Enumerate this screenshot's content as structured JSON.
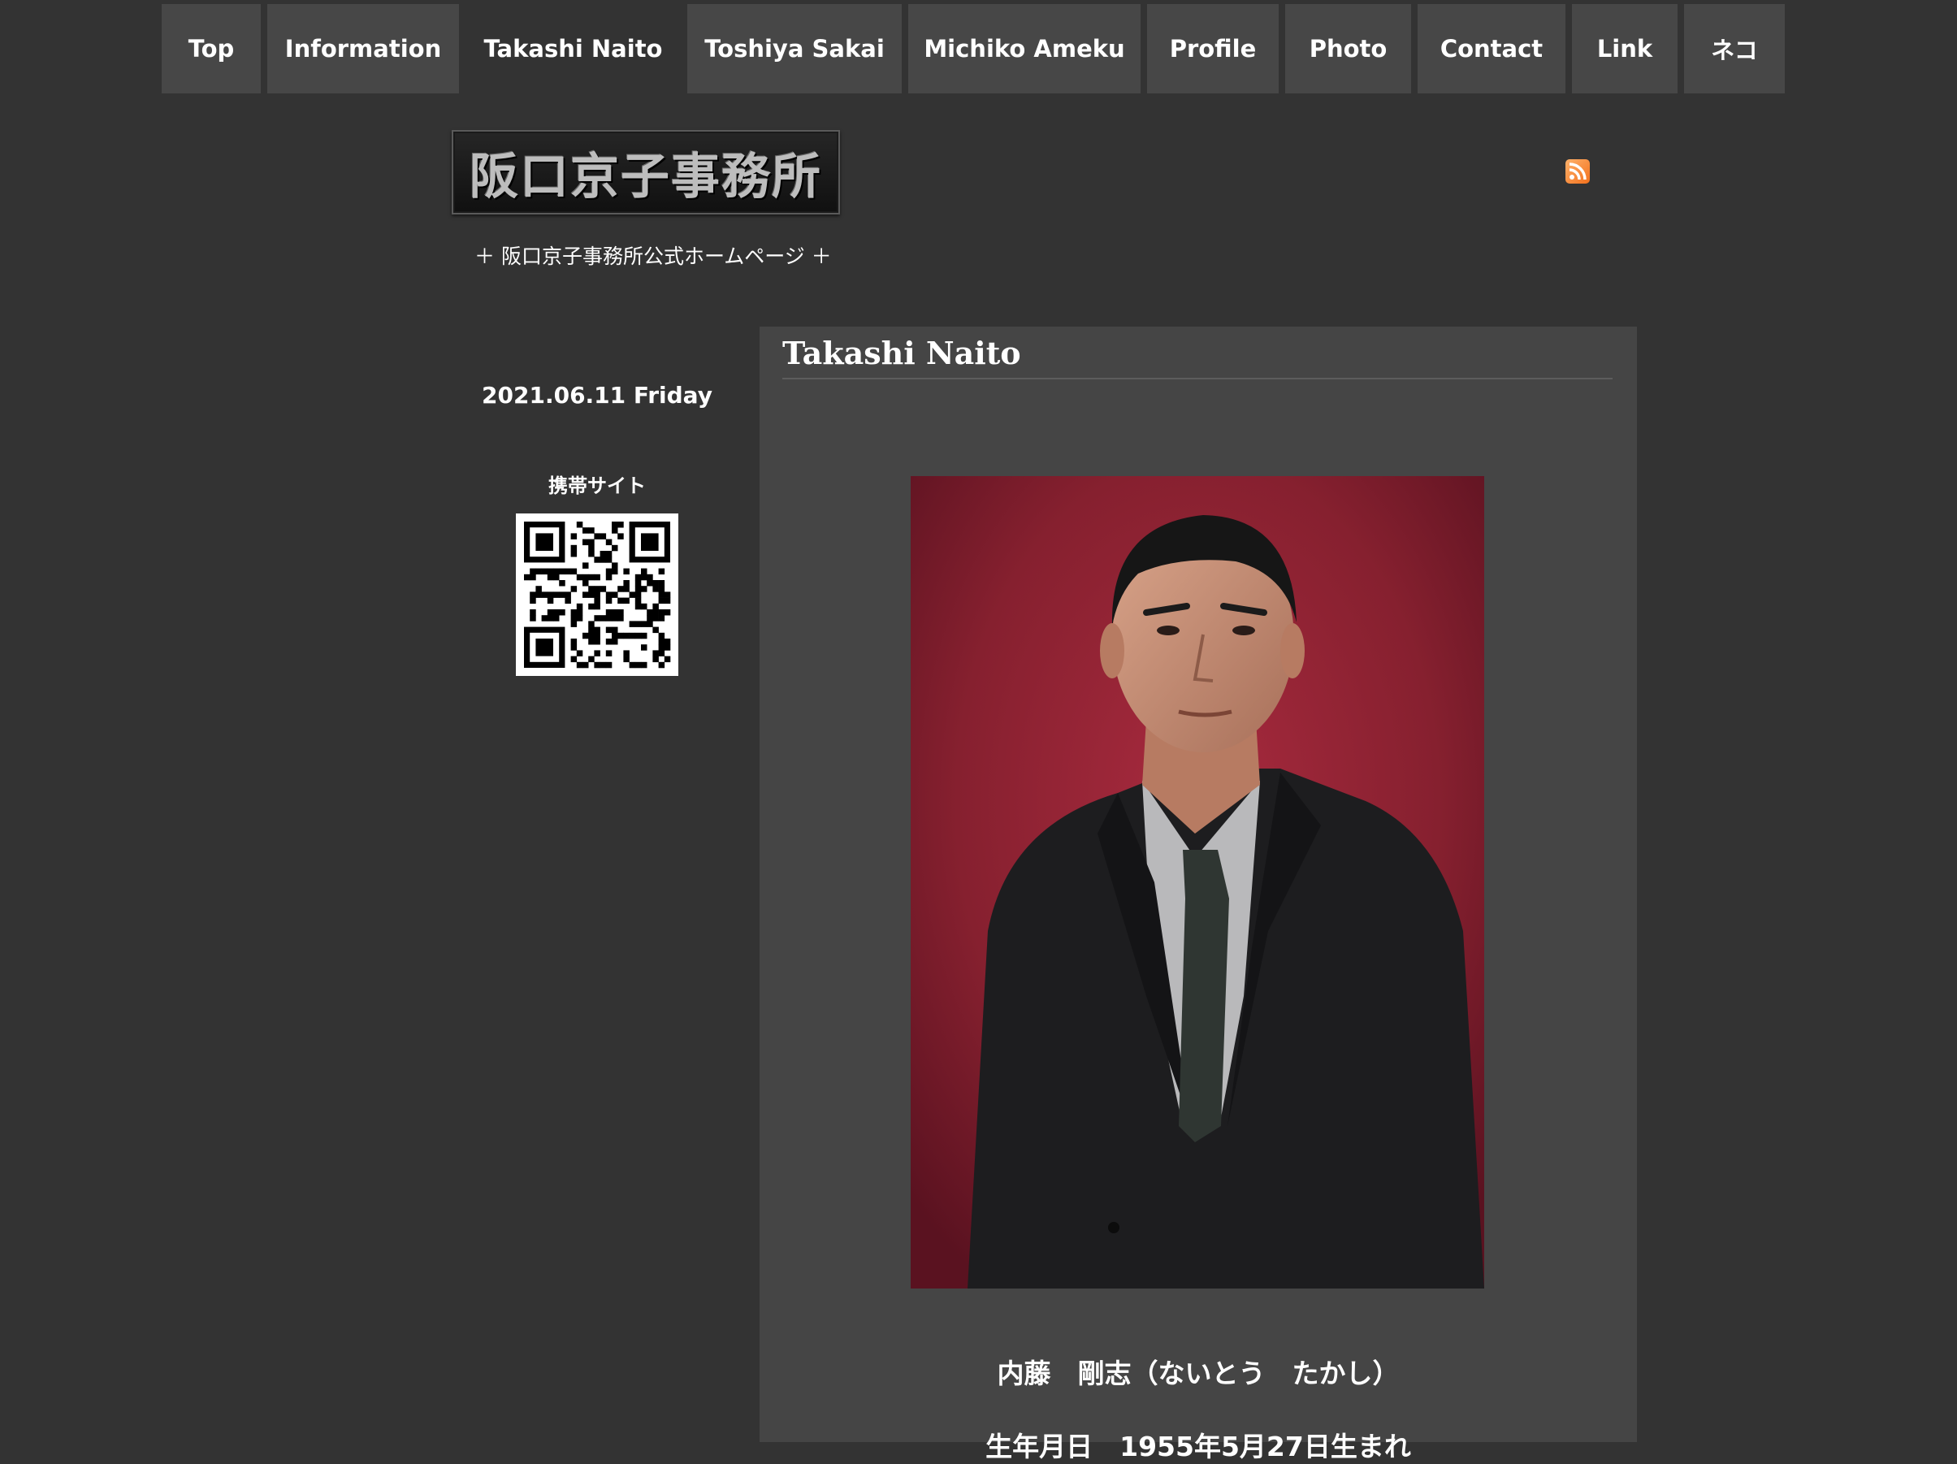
{
  "nav": {
    "items": [
      {
        "label": "Top"
      },
      {
        "label": "Information"
      },
      {
        "label": "Takashi Naito"
      },
      {
        "label": "Toshiya Sakai"
      },
      {
        "label": "Michiko Ameku"
      },
      {
        "label": "Profile"
      },
      {
        "label": "Photo"
      },
      {
        "label": "Contact"
      },
      {
        "label": "Link"
      },
      {
        "label": "ネコ"
      }
    ],
    "active_label": "Takashi Naito"
  },
  "header": {
    "logo_text": "阪口京子事務所",
    "tagline": "＋ 阪口京子事務所公式ホームページ ＋",
    "rss_icon": "rss-feed-icon"
  },
  "sidebar": {
    "date": "2021.06.11 Friday",
    "mobile_title": "携帯サイト",
    "qr_icon": "qr-code"
  },
  "main": {
    "title": "Takashi Naito",
    "photo": "portrait-photo",
    "name": "内藤　剛志（ないとう　たかし）",
    "birth": "生年月日　1955年5月27日生まれ"
  },
  "colors": {
    "background": "#333333",
    "nav_item": "#474747",
    "panel": "#454545",
    "photo_backdrop": "#8a1c2d"
  }
}
